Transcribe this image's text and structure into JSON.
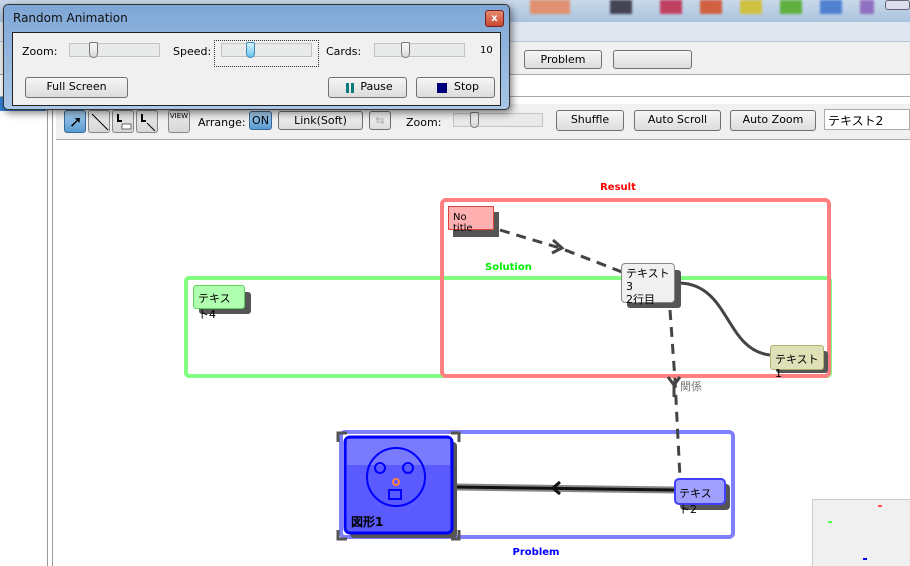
{
  "dialog": {
    "title": "Random Animation",
    "close_label": "x",
    "zoom_label": "Zoom:",
    "speed_label": "Speed:",
    "cards_label": "Cards:",
    "cards_value": "10",
    "zoom_level": 0.25,
    "speed_level": 0.3,
    "cards_level": 0.3,
    "full_screen_label": "Full Screen",
    "pause_label": "Pause",
    "stop_label": "Stop",
    "colors": {
      "pause": "#0a7a7a",
      "stop": "#00007a",
      "close": "#c8472f"
    }
  },
  "background": {
    "problem_label": "Problem",
    "blank_button_label": ""
  },
  "toolbar": {
    "tools": [
      "select-tool",
      "line-tool",
      "label-tool",
      "label-line-tool"
    ],
    "view_label": "VIEW",
    "arrange_label": "Arrange:",
    "arrange_on_label": "ON",
    "link_label": "Link(Soft)",
    "zoom_label": "Zoom:",
    "zoom_level": 0.2,
    "shuffle_label": "Shuffle",
    "auto_scroll_label": "Auto Scroll",
    "auto_zoom_label": "Auto Zoom",
    "search_value": "テキスト2"
  },
  "diagram": {
    "groups": [
      {
        "label": "Result",
        "color": "#ff8080",
        "label_color": "#ff0000"
      },
      {
        "label": "Solution",
        "color": "#80ff80",
        "label_color": "#00ee00"
      },
      {
        "label": "Problem",
        "color": "#8080ff",
        "label_color": "#0000ff"
      }
    ],
    "cards": [
      {
        "label": "No title",
        "color": "#ffb0b0"
      },
      {
        "label1": "テキスト3",
        "label2": "2行目",
        "color": "#f0f0f0"
      },
      {
        "label": "テキスト4",
        "color": "#b0ffb0"
      },
      {
        "label": "テキスト1",
        "color": "#e0e0b8"
      },
      {
        "label": "テキスト2",
        "color": "#a0a0ff"
      },
      {
        "label": "図形1",
        "color": "#5a5aff"
      }
    ],
    "link_label": "関係"
  }
}
